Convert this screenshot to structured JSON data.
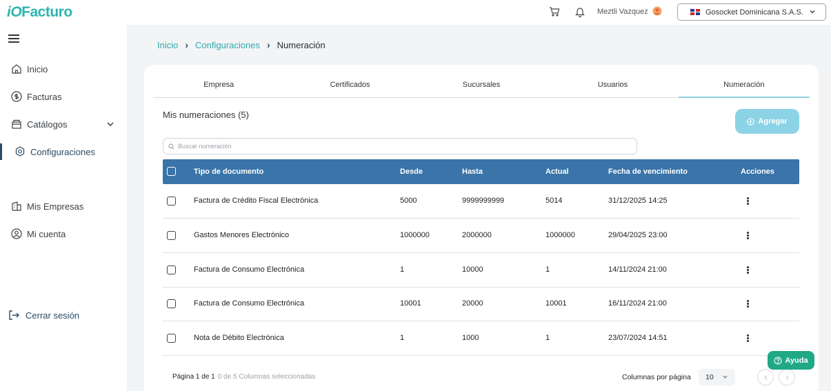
{
  "app": {
    "logo_prefix": "iO",
    "logo_name": "Facturo"
  },
  "topbar": {
    "user_name": "Meztli Vazquez",
    "company": "Gosocket Dominicana S.A.S.",
    "icons": [
      "cart-icon",
      "bell-icon",
      "avatar-icon",
      "chevron-down-icon"
    ]
  },
  "sidebar": {
    "items": [
      {
        "label": "Inicio",
        "icon": "home-icon"
      },
      {
        "label": "Facturas",
        "icon": "dollar-circle-icon"
      },
      {
        "label": "Catálogos",
        "icon": "catalog-icon"
      },
      {
        "label": "Configuraciones",
        "icon": "gear-icon",
        "active": true
      },
      {
        "label": "Mis Empresas",
        "icon": "building-icon"
      },
      {
        "label": "Mi cuenta",
        "icon": "user-circle-icon"
      }
    ],
    "logout": "Cerrar sesión"
  },
  "breadcrumb": [
    "Inicio",
    "Configuraciones",
    "Numeración"
  ],
  "tabs": [
    "Empresa",
    "Certificados",
    "Sucursales",
    "Usuarios",
    "Numeración"
  ],
  "section": {
    "title": "Mis numeraciones (5)",
    "add_label": "Agregar"
  },
  "search": {
    "placeholder": "Buscar numeración"
  },
  "table": {
    "headers": [
      "Tipo de documento",
      "Desde",
      "Hasta",
      "Actual",
      "Fecha de vencimiento",
      "Acciones"
    ],
    "rows": [
      [
        "Factura de Crédito Fiscal Electrónica",
        "5000",
        "9999999999",
        "5014",
        "31/12/2025 14:25"
      ],
      [
        "Gastos Menores Electrónico",
        "1000000",
        "2000000",
        "1000000",
        "29/04/2025 23:00"
      ],
      [
        "Factura de Consumo Electrónica",
        "1",
        "10000",
        "1",
        "14/11/2024 21:00"
      ],
      [
        "Factura de Consumo Electrónica",
        "10001",
        "20000",
        "10001",
        "16/11/2024 21:00"
      ],
      [
        "Nota de Débito Electrónica",
        "1",
        "1000",
        "1",
        "23/07/2024 14:51"
      ]
    ]
  },
  "footer": {
    "page_info": "Página 1 de 1",
    "selection_info": "0 de 5 Columnas seleccionadas",
    "per_page_label": "Columnas por página",
    "per_page_value": "10"
  },
  "help": {
    "label": "Ayuda"
  },
  "colors": {
    "accent": "#2db5b0",
    "header": "#3a74a8",
    "add_button": "#8dd3e6",
    "help": "#20a887"
  }
}
